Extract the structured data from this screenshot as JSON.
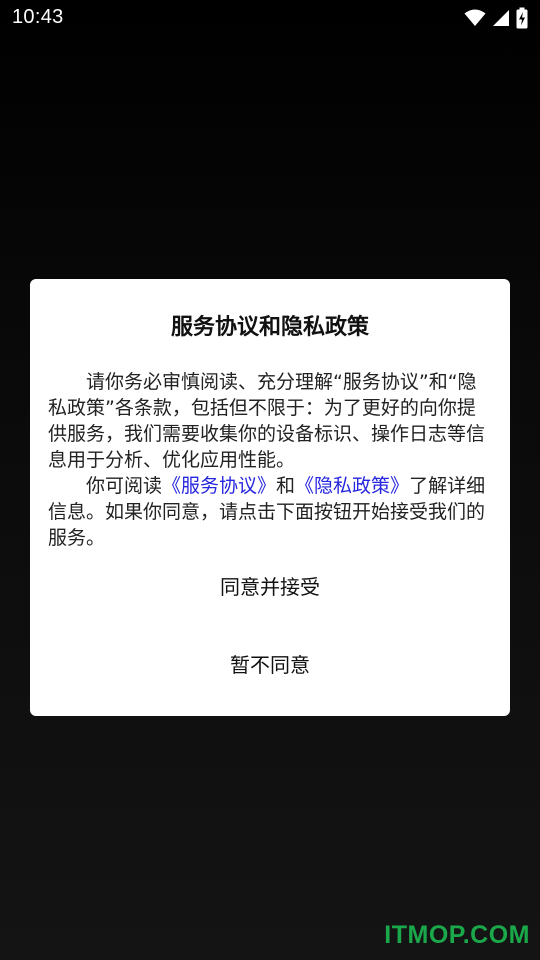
{
  "status_bar": {
    "time": "10:43",
    "icons": [
      "wifi-icon",
      "cellular-signal-icon",
      "battery-charging-icon"
    ]
  },
  "dialog": {
    "title": "服务协议和隐私政策",
    "paragraph1": "请你务必审慎阅读、充分理解“服务协议”和“隐私政策”各条款，包括但不限于：为了更好的向你提供服务，我们需要收集你的设备标识、操作日志等信息用于分析、优化应用性能。",
    "paragraph2_prefix": "你可阅读",
    "service_link": "《服务协议》",
    "paragraph2_and": "和",
    "privacy_link": "《隐私政策》",
    "paragraph2_suffix": "了解详细信息。如果你同意，请点击下面按钮开始接受我们的服务。",
    "accept_label": "同意并接受",
    "decline_label": "暂不同意"
  },
  "watermark": "ITMOP.COM",
  "colors": {
    "background": "#000000",
    "dialog_background": "#ffffff",
    "link": "#2626e0",
    "watermark": "#1aa84a"
  }
}
